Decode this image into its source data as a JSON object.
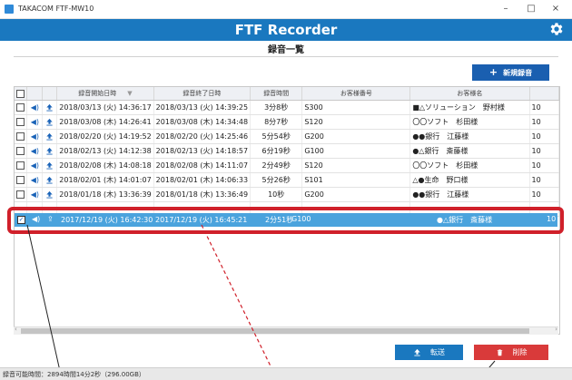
{
  "window": {
    "title": "TAKACOM FTF-MW10",
    "controls": [
      "–",
      "□",
      "×"
    ]
  },
  "header": {
    "app_title": "FTF Recorder"
  },
  "page": {
    "title": "録音一覧"
  },
  "toolbar": {
    "new_label": "新規録音",
    "new_icon": "plus-icon"
  },
  "table": {
    "columns": [
      "",
      "",
      "",
      "録音開始日時",
      "録音終了日時",
      "録音時間",
      "お客様番号",
      "お客様名",
      ""
    ],
    "rows": [
      {
        "start": "2018/03/13 (火) 14:36:17",
        "end": "2018/03/13 (火) 14:39:25",
        "duration": "3分8秒",
        "customer_no": "S300",
        "customer_name": "■△ソリューション　野村様",
        "extra": "10"
      },
      {
        "start": "2018/03/08 (木) 14:26:41",
        "end": "2018/03/08 (木) 14:34:48",
        "duration": "8分7秒",
        "customer_no": "S120",
        "customer_name": "〇〇ソフト　杉田様",
        "extra": "10"
      },
      {
        "start": "2018/02/20 (火) 14:19:52",
        "end": "2018/02/20 (火) 14:25:46",
        "duration": "5分54秒",
        "customer_no": "G200",
        "customer_name": "●●銀行　江藤様",
        "extra": "10"
      },
      {
        "start": "2018/02/13 (火) 14:12:38",
        "end": "2018/02/13 (火) 14:18:57",
        "duration": "6分19秒",
        "customer_no": "G100",
        "customer_name": "●△銀行　斎藤様",
        "extra": "10"
      },
      {
        "start": "2018/02/08 (木) 14:08:18",
        "end": "2018/02/08 (木) 14:11:07",
        "duration": "2分49秒",
        "customer_no": "S120",
        "customer_name": "〇〇ソフト　杉田様",
        "extra": "10"
      },
      {
        "start": "2018/02/01 (木) 14:01:07",
        "end": "2018/02/01 (木) 14:06:33",
        "duration": "5分26秒",
        "customer_no": "S101",
        "customer_name": "△●生命　野口様",
        "extra": "10"
      },
      {
        "start": "2018/01/18 (木) 13:36:39",
        "end": "2018/01/18 (木) 13:36:49",
        "duration": "10秒",
        "customer_no": "G200",
        "customer_name": "●●銀行　江藤様",
        "extra": "10"
      }
    ]
  },
  "selected_row": {
    "start": "2017/12/19 (火) 16:42:30",
    "end": "2017/12/19 (火) 16:45:21",
    "duration": "2分51秒",
    "customer_no": "G100",
    "customer_name": "●△銀行　斎藤様",
    "extra": "10",
    "checked": true
  },
  "actions": {
    "send_label": "転送",
    "delete_label": "削除"
  },
  "status": {
    "text": "録音可能時間：2894時間14分2秒（296.00GB）"
  },
  "colors": {
    "header": "#1a78bf",
    "accent_dark": "#1a5fb0",
    "delete": "#d93a3a",
    "callout": "#d0202a",
    "selected_row": "#4aa3dd"
  }
}
